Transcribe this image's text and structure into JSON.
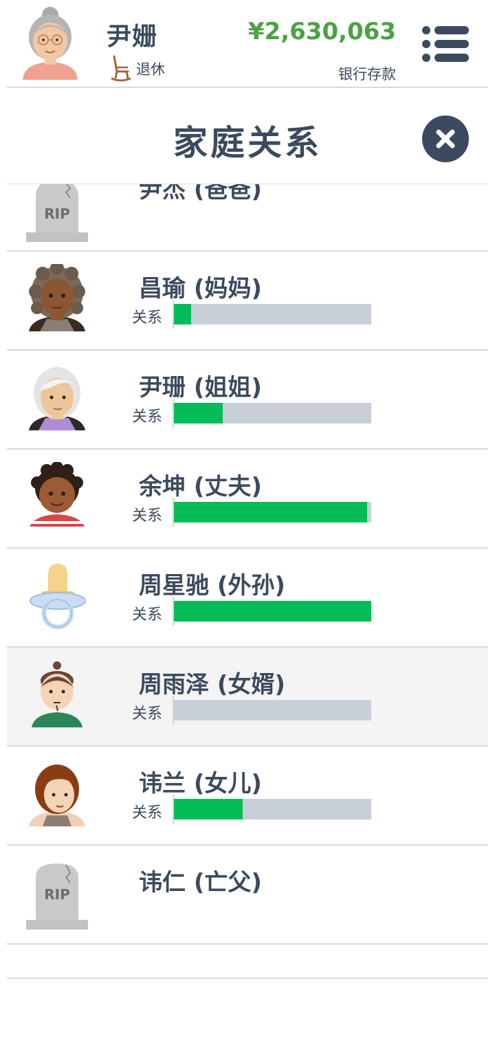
{
  "header": {
    "player_name": "尹姗",
    "status": "退休",
    "money": "¥2,630,063",
    "money_label": "银行存款"
  },
  "panel": {
    "title": "家庭关系"
  },
  "relationship_label": "关系",
  "family": [
    {
      "name": "尹杰 (爸爸)",
      "deceased": true,
      "avatar": "tombstone-icon"
    },
    {
      "name": "昌瑜 (妈妈)",
      "relationship": 0.09,
      "avatar": "curly-hair-woman-avatar"
    },
    {
      "name": "尹珊 (姐姐)",
      "relationship": 0.25,
      "avatar": "elderly-woman-avatar"
    },
    {
      "name": "余坤 (丈夫)",
      "relationship": 0.98,
      "avatar": "man-avatar"
    },
    {
      "name": "周星驰 (外孙)",
      "relationship": 1.0,
      "avatar": "pacifier-icon"
    },
    {
      "name": "周雨泽 (女婿)",
      "relationship": 0.0,
      "avatar": "man-bun-avatar"
    },
    {
      "name": "讳兰 (女儿)",
      "relationship": 0.35,
      "avatar": "woman-avatar"
    },
    {
      "name": "讳仁 (亡父)",
      "deceased": true,
      "avatar": "tombstone-icon"
    }
  ],
  "colors": {
    "text": "#3b4a5e",
    "money": "#4aa244",
    "bar_fill": "#05bd58",
    "bar_bg": "#c8cfd8",
    "highlight_row": "#f4f4f4"
  }
}
